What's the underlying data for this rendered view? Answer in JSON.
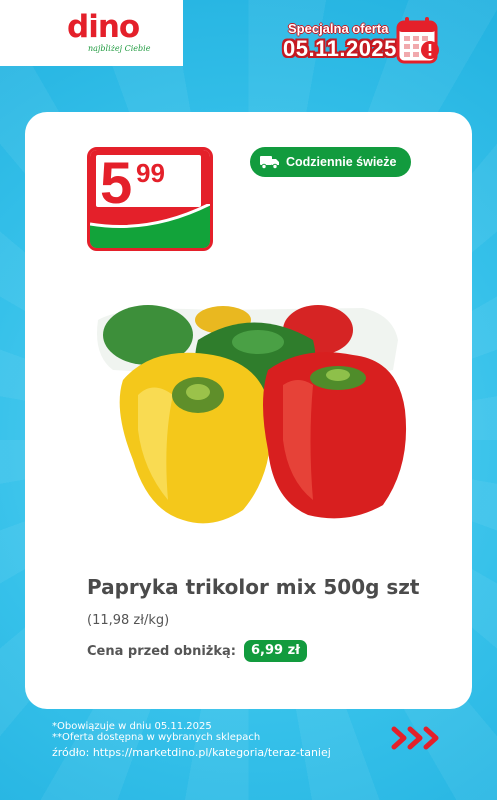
{
  "header": {
    "logo_text": "dino",
    "logo_tagline": "najbliżej Ciebie",
    "offer_title": "Specjalna oferta",
    "offer_date": "05.11.2025",
    "calendar_icon": "calendar-alert-icon"
  },
  "product": {
    "price_main": "5",
    "price_cents": "99",
    "badge_label": "Codziennie świeże",
    "badge_icon": "truck-icon",
    "name": "Papryka trikolor mix 500g szt",
    "unit_price": "(11,98 zł/kg)",
    "previous_price_label": "Cena przed obniżką:",
    "previous_price_value": "6,99 zł",
    "image_icon": "bell-peppers-image"
  },
  "footer": {
    "note_1": "*Obowiązuje w dniu 05.11.2025",
    "note_2": "**Oferta dostępna w wybranych sklepach",
    "source": "źródło: https://marketdino.pl/kategoria/teraz-taniej",
    "arrows_icon": "triple-chevron-right-icon"
  },
  "colors": {
    "brand_red": "#e4202a",
    "brand_green": "#129b3e",
    "background_blue": "#36c1ea"
  }
}
